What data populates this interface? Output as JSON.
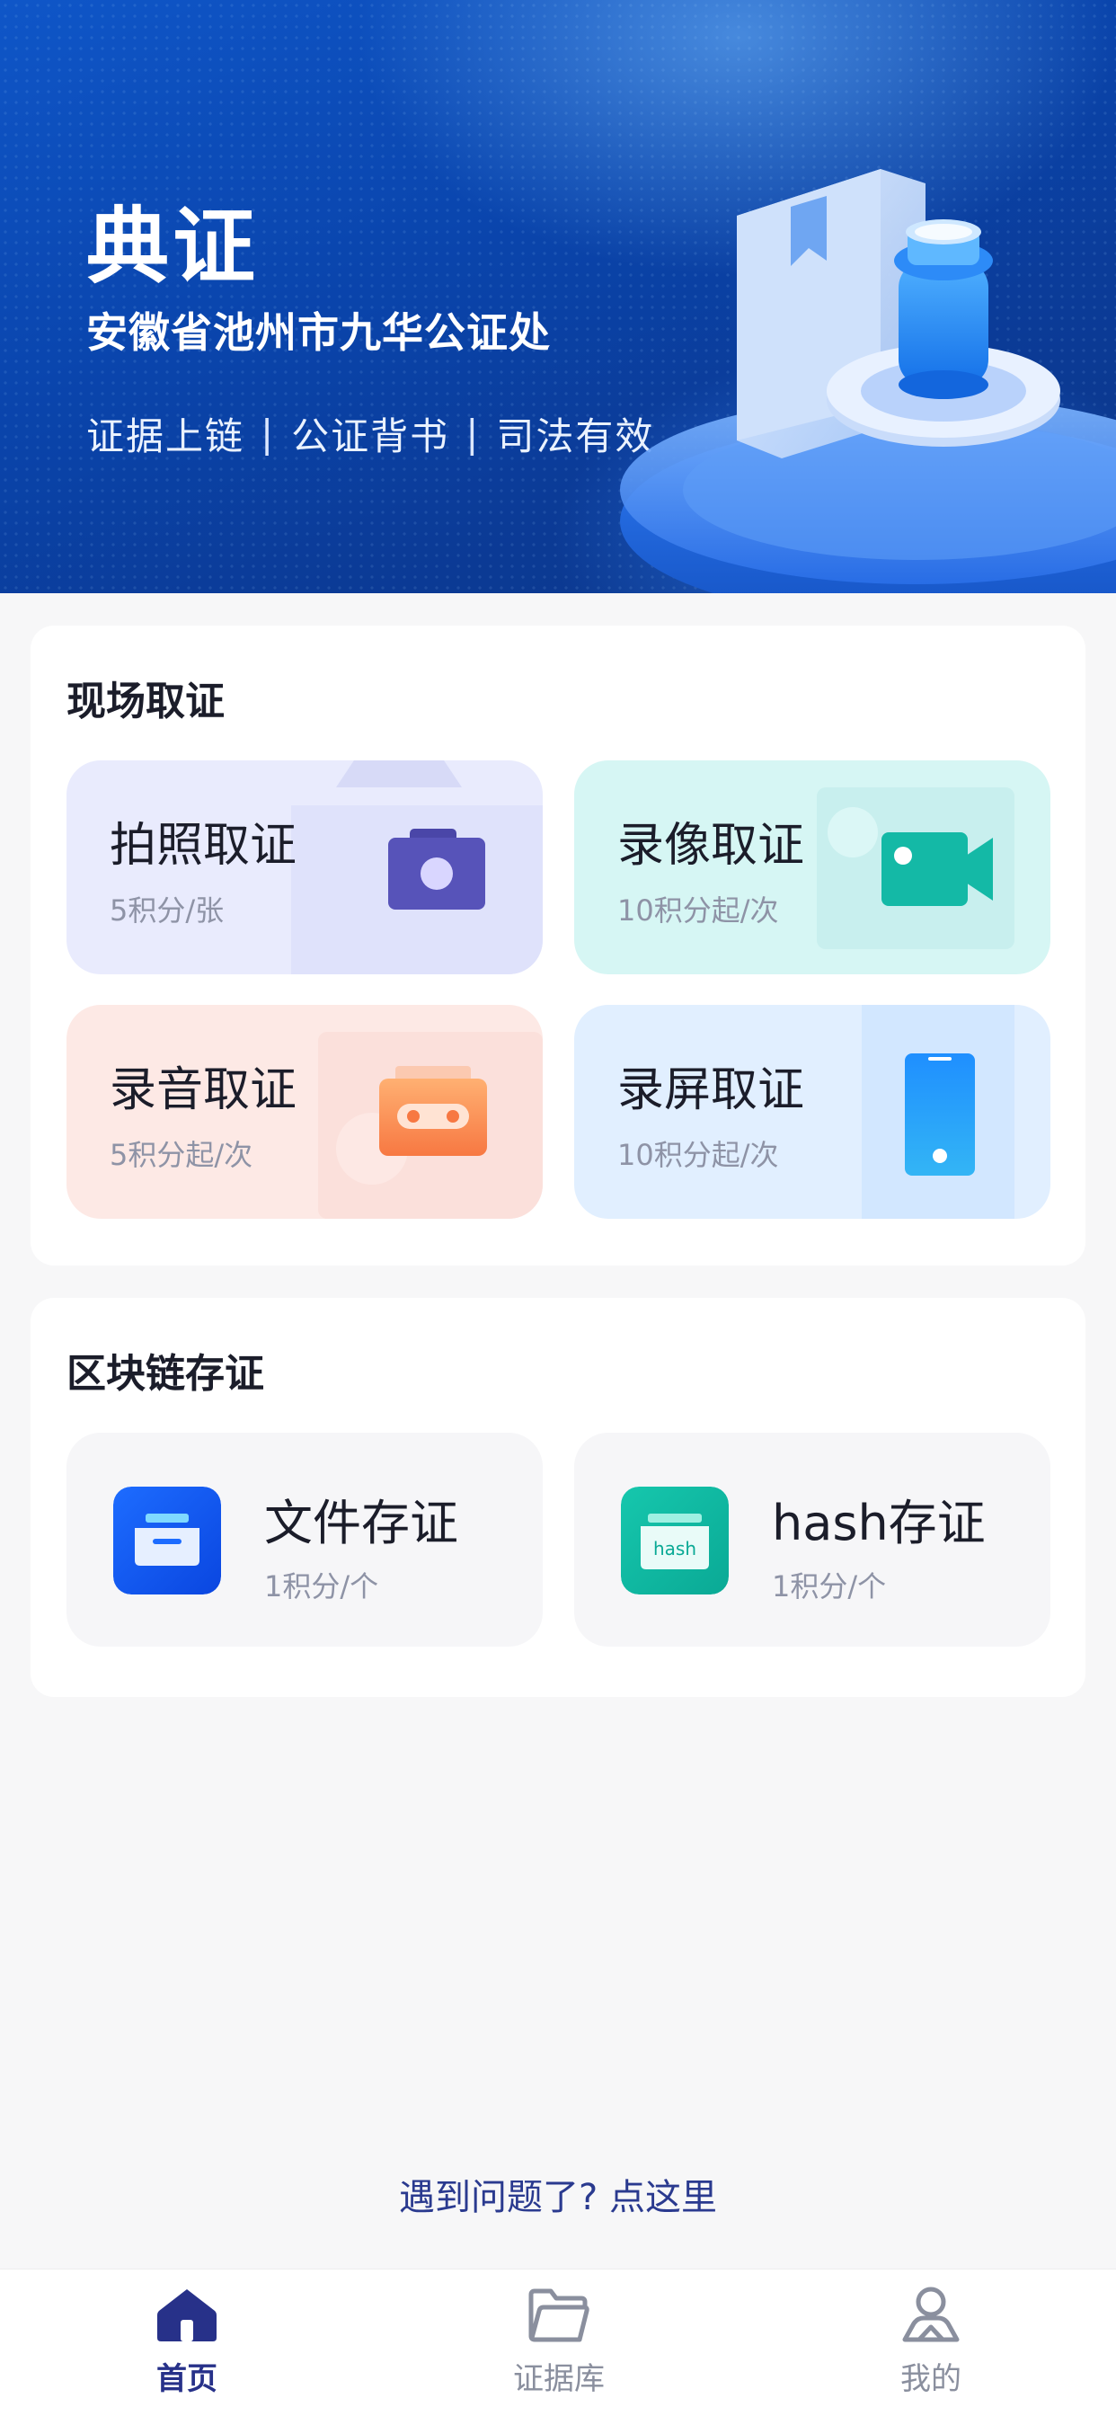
{
  "banner": {
    "title": "典证",
    "subtitle": "安徽省池州市九华公证处",
    "tags": [
      "证据上链",
      "公证背书",
      "司法有效"
    ],
    "separator": "|"
  },
  "onsite": {
    "title": "现场取证",
    "items": [
      {
        "label": "拍照取证",
        "price": "5积分/张",
        "icon": "camera-icon"
      },
      {
        "label": "录像取证",
        "price": "10积分起/次",
        "icon": "video-camera-icon"
      },
      {
        "label": "录音取证",
        "price": "5积分起/次",
        "icon": "cassette-icon"
      },
      {
        "label": "录屏取证",
        "price": "10积分起/次",
        "icon": "phone-icon"
      }
    ]
  },
  "blockchain": {
    "title": "区块链存证",
    "items": [
      {
        "label": "文件存证",
        "price": "1积分/个",
        "icon": "file-tray-icon"
      },
      {
        "label": "hash存证",
        "price": "1积分/个",
        "icon": "hash-icon",
        "icon_text": "hash"
      }
    ]
  },
  "help": {
    "label": "遇到问题了? 点这里"
  },
  "tabbar": {
    "items": [
      {
        "label": "首页",
        "icon": "home-icon",
        "active": true
      },
      {
        "label": "证据库",
        "icon": "folder-icon",
        "active": false
      },
      {
        "label": "我的",
        "icon": "user-icon",
        "active": false
      }
    ]
  },
  "colors": {
    "banner": "#0b46ad",
    "accent": "#273189",
    "photo_tile": "#e9ebfd",
    "video_tile": "#d6f6f4",
    "audio_tile": "#fde9e5",
    "screen_tile": "#e1efff"
  }
}
